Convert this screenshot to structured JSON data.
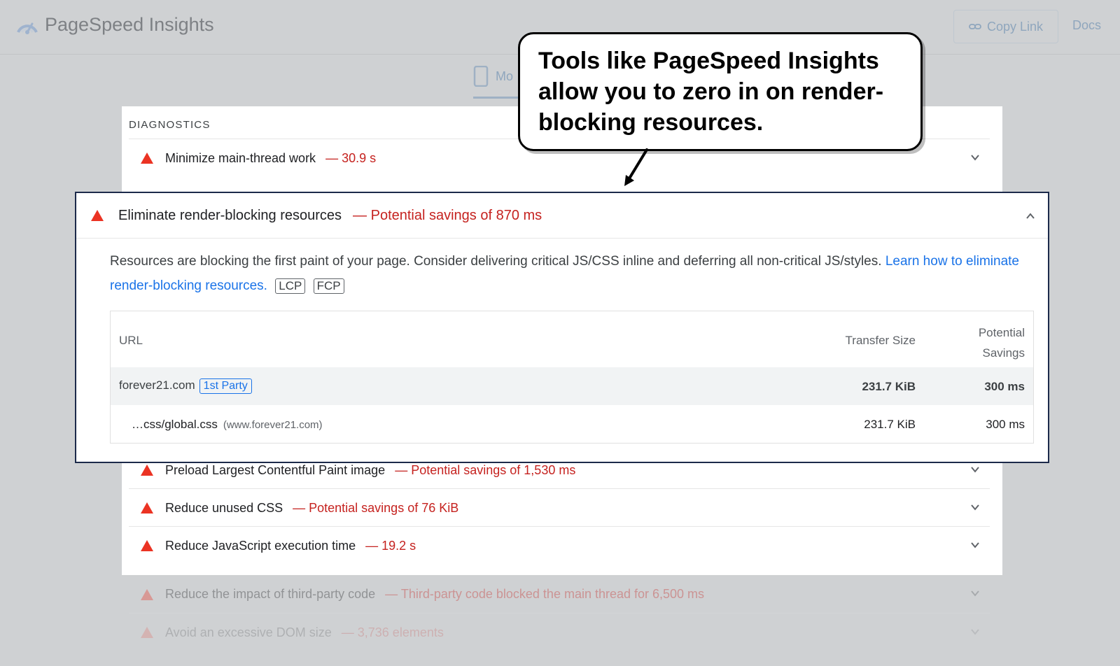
{
  "header": {
    "app_title": "PageSpeed Insights",
    "copy_link_label": "Copy Link",
    "docs_label": "Docs",
    "device_tab_label": "Mo"
  },
  "diagnostics": {
    "section_title": "DIAGNOSTICS",
    "audits": [
      {
        "title": "Minimize main-thread work",
        "detail": "— 30.9 s"
      },
      {
        "title": "Preload Largest Contentful Paint image",
        "detail": "— Potential savings of 1,530 ms"
      },
      {
        "title": "Reduce unused CSS",
        "detail": "— Potential savings of 76 KiB"
      },
      {
        "title": "Reduce JavaScript execution time",
        "detail": "— 19.2 s"
      },
      {
        "title": "Reduce the impact of third-party code",
        "detail": "— Third-party code blocked the main thread for 6,500 ms"
      },
      {
        "title": "Avoid an excessive DOM size",
        "detail": "— 3,736 elements"
      }
    ]
  },
  "expanded_audit": {
    "title": "Eliminate render-blocking resources",
    "detail": "— Potential savings of 870 ms",
    "description": "Resources are blocking the first paint of your page. Consider delivering critical JS/CSS inline and deferring all non-critical JS/styles.",
    "learn_link": "Learn how to eliminate render-blocking resources.",
    "tags": [
      "LCP",
      "FCP"
    ],
    "table": {
      "headers": {
        "url": "URL",
        "transfer_size": "Transfer Size",
        "savings_line1": "Potential",
        "savings_line2": "Savings"
      },
      "group_row": {
        "url": "forever21.com",
        "badge": "1st Party",
        "transfer_size": "231.7 KiB",
        "savings": "300 ms"
      },
      "item_row": {
        "url": "…css/global.css",
        "host": "(www.forever21.com)",
        "transfer_size": "231.7 KiB",
        "savings": "300 ms"
      }
    }
  },
  "callout": {
    "text": "Tools like PageSpeed Insights allow you to zero in on render-blocking resources."
  },
  "colors": {
    "fail_red": "#c5221f",
    "warn_triangle": "#eb3323",
    "link_blue": "#1a73e8",
    "highlight_border": "#1c2a4a"
  }
}
